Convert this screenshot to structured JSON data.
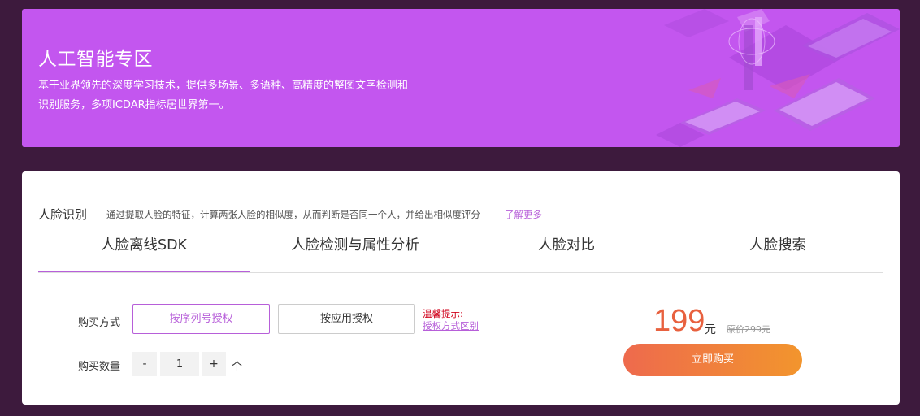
{
  "banner": {
    "title": "人工智能专区",
    "desc_line1": "基于业界领先的深度学习技术，提供多场景、多语种、高精度的整图文字检测和",
    "desc_line2": "识别服务，多项ICDAR指标居世界第一。"
  },
  "section": {
    "heading": "人脸识别",
    "desc": "通过提取人脸的特征，计算两张人脸的相似度，从而判断是否同一个人，并给出相似度评分",
    "learn_more": "了解更多"
  },
  "tabs": [
    {
      "label": "人脸离线SDK",
      "active": true
    },
    {
      "label": "人脸检测与属性分析",
      "active": false
    },
    {
      "label": "人脸对比",
      "active": false
    },
    {
      "label": "人脸搜索",
      "active": false
    }
  ],
  "purchase": {
    "method_label": "购买方式",
    "options": [
      {
        "label": "按序列号授权",
        "selected": true
      },
      {
        "label": "按应用授权",
        "selected": false
      }
    ],
    "tip_title": "温馨提示:",
    "tip_link": "授权方式区别",
    "qty_label": "购买数量",
    "minus": "-",
    "plus": "+",
    "qty_value": "1",
    "qty_unit": "个"
  },
  "pricing": {
    "price": "199",
    "unit": "元",
    "original": "原价299元",
    "buy_label": "立即购买"
  },
  "colors": {
    "accent": "#b75fd9",
    "banner": "#c356ef",
    "price": "#e8613f",
    "page_bg": "#3d1a3d"
  }
}
